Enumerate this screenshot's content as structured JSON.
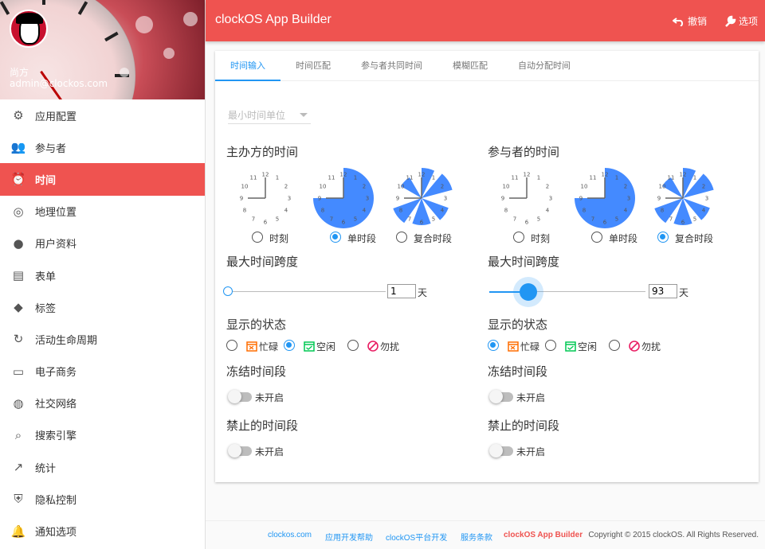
{
  "user": {
    "name": "尚方",
    "email": "admin@clockos.com"
  },
  "nav": [
    {
      "label": "应用配置",
      "icon": "gear-icon",
      "glyph": "⚙"
    },
    {
      "label": "参与者",
      "icon": "people-icon",
      "glyph": "👥"
    },
    {
      "label": "时间",
      "icon": "alarm-icon",
      "glyph": "⏰"
    },
    {
      "label": "地理位置",
      "icon": "location-icon",
      "glyph": "◎"
    },
    {
      "label": "用户资料",
      "icon": "account-icon",
      "glyph": "●"
    },
    {
      "label": "表单",
      "icon": "clipboard-icon",
      "glyph": "▤"
    },
    {
      "label": "标签",
      "icon": "label-icon",
      "glyph": "◆"
    },
    {
      "label": "活动生命周期",
      "icon": "refresh-icon",
      "glyph": "↻"
    },
    {
      "label": "电子商务",
      "icon": "credit-card-icon",
      "glyph": "▭"
    },
    {
      "label": "社交网络",
      "icon": "globe-icon",
      "glyph": "◍"
    },
    {
      "label": "搜索引擎",
      "icon": "search-icon",
      "glyph": "⌕"
    },
    {
      "label": "统计",
      "icon": "trending-icon",
      "glyph": "↗"
    },
    {
      "label": "隐私控制",
      "icon": "shield-icon",
      "glyph": "⛨"
    },
    {
      "label": "通知选项",
      "icon": "bell-icon",
      "glyph": "🔔"
    }
  ],
  "active_nav": "时间",
  "header": {
    "title": "clockOS App Builder",
    "undo_label": "撤销",
    "options_label": "选项"
  },
  "tabs": [
    "时间输入",
    "时间匹配",
    "参与者共同时间",
    "模糊匹配",
    "自动分配时间"
  ],
  "active_tab": "时间输入",
  "min_unit_placeholder": "最小时间单位",
  "left": {
    "title": "主办方的时间",
    "modes": [
      "时刻",
      "单时段",
      "复合时段"
    ],
    "selected_mode": "单时段",
    "span_title": "最大时间跨度",
    "span_value": "1",
    "span_unit": "天",
    "status_title": "显示的状态",
    "statuses": [
      "忙碌",
      "空闲",
      "勿扰"
    ],
    "selected_status": "空闲",
    "freeze_title": "冻结时间段",
    "freeze_state": "未开启",
    "forbid_title": "禁止的时间段",
    "forbid_state": "未开启"
  },
  "right": {
    "title": "参与者的时间",
    "modes": [
      "时刻",
      "单时段",
      "复合时段"
    ],
    "selected_mode": "复合时段",
    "span_title": "最大时间跨度",
    "span_value": "93",
    "span_unit": "天",
    "status_title": "显示的状态",
    "statuses": [
      "忙碌",
      "空闲",
      "勿扰"
    ],
    "selected_status": "忙碌",
    "freeze_title": "冻结时间段",
    "freeze_state": "未开启",
    "forbid_title": "禁止的时间段",
    "forbid_state": "未开启"
  },
  "clock_numbers": [
    "12",
    "1",
    "2",
    "3",
    "4",
    "5",
    "6",
    "7",
    "8",
    "9",
    "10",
    "11"
  ],
  "colors": {
    "primary": "#ef5350",
    "accent": "#2196f3",
    "busy": "#ff6d00",
    "free": "#00c853",
    "dnd": "#e91e63"
  },
  "footer": {
    "links": [
      "clockos.com",
      "应用开发帮助",
      "clockOS平台开发",
      "服务条款",
      "clockOS App Builder"
    ],
    "copyright": "Copyright © 2015 clockOS. All Rights Reserved."
  }
}
